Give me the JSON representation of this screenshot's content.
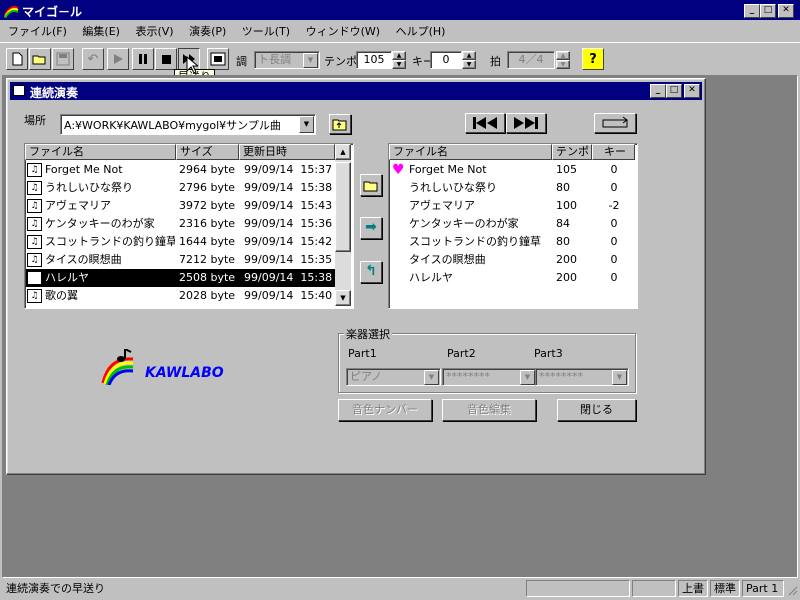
{
  "app": {
    "title": "マイゴ－ル"
  },
  "menu": [
    "ファイル(F)",
    "編集(E)",
    "表示(V)",
    "演奏(P)",
    "ツール(T)",
    "ウィンドウ(W)",
    "ヘルプ(H)"
  ],
  "toolbar": {
    "key_label": "調",
    "key_value": "ト長調",
    "tempo_label": "テンポ",
    "tempo_value": "105",
    "transpose_label": "キー",
    "transpose_value": "0",
    "beat_label": "拍",
    "beat_value": "4／4",
    "tooltip": "早送り"
  },
  "child_window": {
    "title": "連続演奏"
  },
  "location": {
    "label": "場所",
    "path": "A:¥WORK¥KAWLABO¥mygol¥サンプル曲"
  },
  "file_list": {
    "columns": [
      "ファイル名",
      "サイズ",
      "更新日時"
    ],
    "rows": [
      {
        "name": "Forget Me Not",
        "size": "2964 byte",
        "date": "99/09/14  15:37",
        "selected": false
      },
      {
        "name": "うれしいひな祭り",
        "size": "2796 byte",
        "date": "99/09/14  15:38",
        "selected": false
      },
      {
        "name": "アヴェマリア",
        "size": "3972 byte",
        "date": "99/09/14  15:43",
        "selected": false
      },
      {
        "name": "ケンタッキーのわが家",
        "size": "2316 byte",
        "date": "99/09/14  15:36",
        "selected": false
      },
      {
        "name": "スコットランドの釣り鐘草",
        "size": "1644 byte",
        "date": "99/09/14  15:42",
        "selected": false
      },
      {
        "name": "タイスの瞑想曲",
        "size": "7212 byte",
        "date": "99/09/14  15:35",
        "selected": false
      },
      {
        "name": "ハレルヤ",
        "size": "2508 byte",
        "date": "99/09/14  15:38",
        "selected": true
      },
      {
        "name": "歌の翼",
        "size": "2028 byte",
        "date": "99/09/14  15:40",
        "selected": false
      }
    ]
  },
  "playlist": {
    "columns": [
      "ファイル名",
      "テンポ",
      "キー"
    ],
    "rows": [
      {
        "name": "Forget Me Not",
        "tempo": "105",
        "key": "0",
        "playing": true
      },
      {
        "name": "うれしいひな祭り",
        "tempo": "80",
        "key": "0",
        "playing": false
      },
      {
        "name": "アヴェマリア",
        "tempo": "100",
        "key": "-2",
        "playing": false
      },
      {
        "name": "ケンタッキーのわが家",
        "tempo": "84",
        "key": "0",
        "playing": false
      },
      {
        "name": "スコットランドの釣り鐘草",
        "tempo": "80",
        "key": "0",
        "playing": false
      },
      {
        "name": "タイスの瞑想曲",
        "tempo": "200",
        "key": "0",
        "playing": false
      },
      {
        "name": "ハレルヤ",
        "tempo": "200",
        "key": "0",
        "playing": false
      }
    ]
  },
  "instrument": {
    "group_label": "楽器選択",
    "part1_label": "Part1",
    "part2_label": "Part2",
    "part3_label": "Part3",
    "part1_value": "ピアノ",
    "part2_value": "********",
    "part3_value": "********"
  },
  "buttons": {
    "tone_number": "音色ナンバー",
    "tone_edit": "音色編集",
    "close": "閉じる"
  },
  "logo": {
    "text": "KAWLABO"
  },
  "status": {
    "message": "連続演奏での早送り",
    "overwrite": "上書",
    "standard": "標準",
    "part": "Part 1"
  },
  "colors": {
    "titlebar": "#000080",
    "selection": "#000000",
    "heart": "#ff00ff",
    "logo_text": "#0000ff"
  }
}
